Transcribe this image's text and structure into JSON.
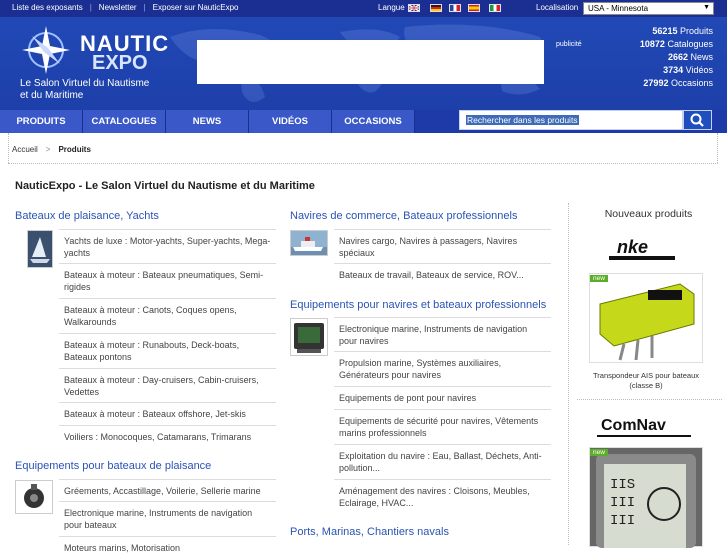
{
  "topbar": {
    "links": [
      "Liste des exposants",
      "Newsletter",
      "Exposer sur NauticExpo"
    ],
    "language_label": "Langue",
    "location_label": "Localisation",
    "location_value": "USA - Minnesota"
  },
  "header": {
    "logo_top": "NAUTIC",
    "logo_bottom": "EXPO",
    "tagline": "Le Salon Virtuel du Nautisme et du Maritime",
    "ad_label": "publicité",
    "stats": [
      {
        "value": "56215",
        "label": "Produits"
      },
      {
        "value": "10872",
        "label": "Catalogues"
      },
      {
        "value": "2662",
        "label": "News"
      },
      {
        "value": "3734",
        "label": "Vidéos"
      },
      {
        "value": "27992",
        "label": "Occasions"
      }
    ]
  },
  "nav": {
    "tabs": [
      "PRODUITS",
      "CATALOGUES",
      "NEWS",
      "VIDÉOS",
      "OCCASIONS"
    ],
    "search_placeholder": "Rechercher dans les produits"
  },
  "breadcrumb": {
    "home": "Accueil",
    "current": "Produits"
  },
  "page_title": "NauticExpo - Le Salon Virtuel du Nautisme et du Maritime",
  "left_column": {
    "cat1": {
      "title": "Bateaux de plaisance, Yachts",
      "items": [
        "Yachts de luxe : Motor-yachts, Super-yachts, Mega-yachts",
        "Bateaux à moteur : Bateaux pneumatiques, Semi-rigides",
        "Bateaux à moteur : Canots, Coques opens, Walkarounds",
        "Bateaux à moteur : Runabouts, Deck-boats, Bateaux pontons",
        "Bateaux à moteur : Day-cruisers, Cabin-cruisers, Vedettes",
        "Bateaux à moteur : Bateaux offshore, Jet-skis",
        "Voiliers : Monocoques, Catamarans, Trimarans"
      ]
    },
    "cat2": {
      "title": "Equipements pour bateaux de plaisance",
      "items": [
        "Gréements, Accastillage, Voilerie, Sellerie marine",
        "Electronique marine, Instruments de navigation pour bateaux",
        "Moteurs marins, Motorisation"
      ]
    }
  },
  "mid_column": {
    "cat1": {
      "title": "Navires de commerce, Bateaux professionnels",
      "items": [
        "Navires cargo, Navires à passagers, Navires spéciaux",
        "Bateaux de travail, Bateaux de service, ROV..."
      ]
    },
    "cat2": {
      "title": "Equipements pour navires et bateaux professionnels",
      "items": [
        "Electronique marine, Instruments de navigation pour navires",
        "Propulsion marine, Systèmes auxiliaires, Générateurs pour navires",
        "Equipements de pont pour navires",
        "Equipements de sécurité pour navires, Vêtements marins professionnels",
        "Exploitation du navire : Eau, Ballast, Déchets, Anti-pollution...",
        "Aménagement des navires : Cloisons, Meubles, Eclairage, HVAC..."
      ]
    },
    "cat3": {
      "title": "Ports, Marinas, Chantiers navals"
    }
  },
  "right_column": {
    "title": "Nouveaux produits",
    "new_tag": "new",
    "product1": {
      "brand": "nke",
      "caption": "Transpondeur AIS pour bateaux (classe B)"
    },
    "product2": {
      "brand": "ComNav"
    }
  },
  "colors": {
    "brand_blue": "#1b2f93",
    "link_blue": "#2a53b4",
    "nav_tab": "#3a58c8",
    "new_green": "#5cae2a"
  }
}
